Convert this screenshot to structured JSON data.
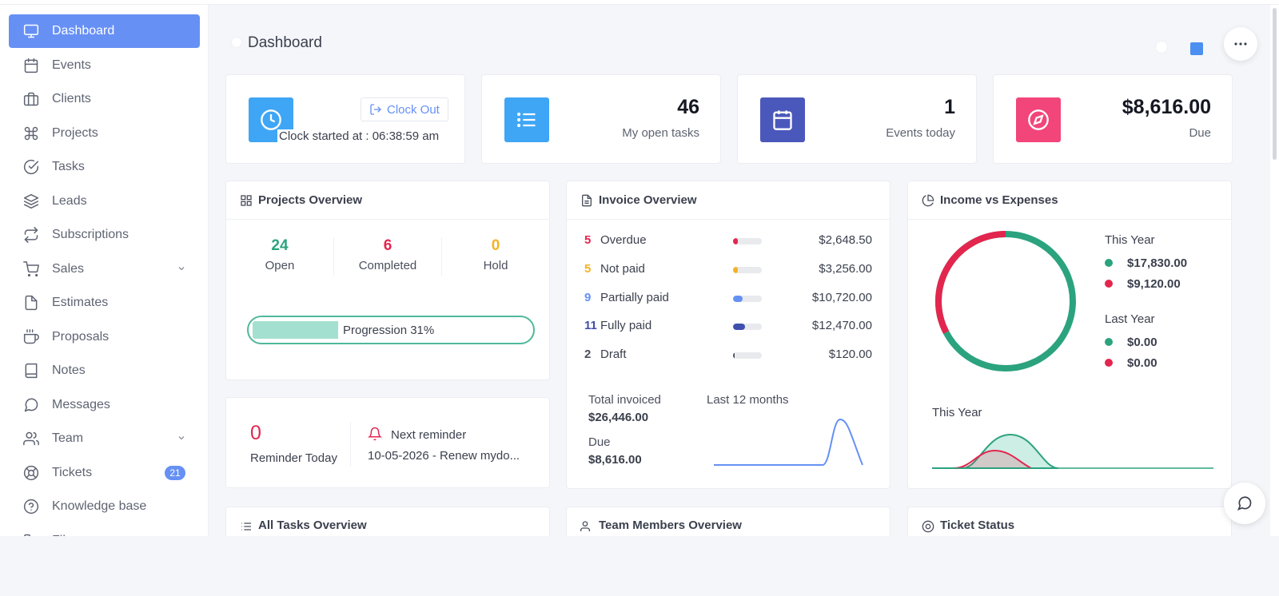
{
  "sidebar": {
    "items": [
      {
        "label": "Dashboard",
        "icon": "monitor-icon",
        "active": true
      },
      {
        "label": "Events",
        "icon": "calendar-icon"
      },
      {
        "label": "Clients",
        "icon": "briefcase-icon"
      },
      {
        "label": "Projects",
        "icon": "command-icon"
      },
      {
        "label": "Tasks",
        "icon": "check-circle-icon"
      },
      {
        "label": "Leads",
        "icon": "layers-icon"
      },
      {
        "label": "Subscriptions",
        "icon": "repeat-icon"
      },
      {
        "label": "Sales",
        "icon": "shopping-cart-icon",
        "has_submenu": true
      },
      {
        "label": "Estimates",
        "icon": "file-icon"
      },
      {
        "label": "Proposals",
        "icon": "coffee-icon"
      },
      {
        "label": "Notes",
        "icon": "book-icon"
      },
      {
        "label": "Messages",
        "icon": "message-circle-icon"
      },
      {
        "label": "Team",
        "icon": "users-icon",
        "has_submenu": true
      },
      {
        "label": "Tickets",
        "icon": "life-buoy-icon",
        "badge": "21"
      },
      {
        "label": "Knowledge base",
        "icon": "help-circle-icon"
      },
      {
        "label": "Files",
        "icon": "folder-icon"
      }
    ]
  },
  "header": {
    "title": "Dashboard",
    "more_icon": "more-horizontal-icon"
  },
  "clock": {
    "button_label": "Clock Out",
    "started_text": "Clock started at : 06:38:59 am",
    "icon": "clock-icon"
  },
  "stats": [
    {
      "value": "46",
      "label": "My open tasks",
      "icon": "list-icon",
      "color": "#3ea6f5"
    },
    {
      "value": "1",
      "label": "Events today",
      "icon": "calendar-icon",
      "color": "#4b58bb"
    },
    {
      "value": "$8,616.00",
      "label": "Due",
      "icon": "compass-icon",
      "color": "#f2457a"
    }
  ],
  "clock_icon_color": "#3ea6f5",
  "projects_overview": {
    "title": "Projects Overview",
    "columns": [
      {
        "value": "24",
        "label": "Open",
        "color": "#2ba37e"
      },
      {
        "value": "6",
        "label": "Completed",
        "color": "#e3264e"
      },
      {
        "value": "0",
        "label": "Hold",
        "color": "#f5b225"
      }
    ],
    "progress_label": "Progression 31%",
    "progress_value": 0.31
  },
  "reminder": {
    "count": "0",
    "count_label": "Reminder Today",
    "next_label": "Next reminder",
    "next_text": "10-05-2026 - Renew mydo..."
  },
  "invoice_overview": {
    "title": "Invoice Overview",
    "rows": [
      {
        "count": "5",
        "name": "Overdue",
        "amount": "$2,648.50",
        "color": "#e3264e",
        "fraction": 0.18
      },
      {
        "count": "5",
        "name": "Not paid",
        "amount": "$3,256.00",
        "color": "#f5b225",
        "fraction": 0.18
      },
      {
        "count": "9",
        "name": "Partially paid",
        "amount": "$10,720.00",
        "color": "#6690f4",
        "fraction": 0.33
      },
      {
        "count": "11",
        "name": "Fully paid",
        "amount": "$12,470.00",
        "color": "#3f4fad",
        "fraction": 0.42
      },
      {
        "count": "2",
        "name": "Draft",
        "amount": "$120.00",
        "color": "#4a4f5c",
        "fraction": 0.05
      }
    ],
    "total_label": "Total invoiced",
    "total_value": "$26,446.00",
    "due_label": "Due",
    "due_value": "$8,616.00",
    "period_label": "Last 12 months"
  },
  "income_expenses": {
    "title": "Income vs Expenses",
    "this_year_label": "This Year",
    "this_year": [
      {
        "value": "$17,830.00",
        "color": "#2ba37e"
      },
      {
        "value": "$9,120.00",
        "color": "#e3264e"
      }
    ],
    "last_year_label": "Last Year",
    "last_year": [
      {
        "value": "$0.00",
        "color": "#2ba37e"
      },
      {
        "value": "$0.00",
        "color": "#e3264e"
      }
    ],
    "chart_label": "This Year"
  },
  "bottom_cards": [
    {
      "title": "All Tasks Overview"
    },
    {
      "title": "Team Members Overview"
    },
    {
      "title": "Ticket Status"
    }
  ]
}
